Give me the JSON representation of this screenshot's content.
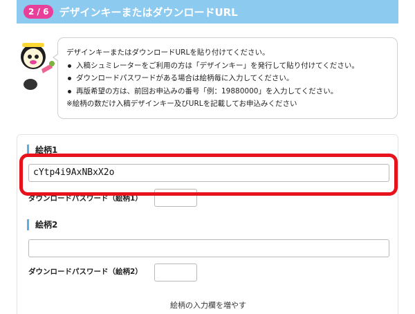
{
  "header": {
    "step": "2 / 6",
    "title": "デザインキーまたはダウンロードURL"
  },
  "info": {
    "lead": "デザインキーまたはダウンロードURLを貼り付けてください。",
    "items": [
      "入稿シュミレーターをご利用の方は「デザインキー」を発行して貼り付けてください。",
      "ダウンロードパスワードがある場合は絵柄毎に入力してください。",
      "再版希望の方は、前回お申込みの番号「例：19880000」を入力してください。"
    ],
    "note": "※絵柄の数だけ入稿デザインキー及びURLを記載してお申込みください"
  },
  "designs": [
    {
      "label": "絵柄1",
      "value": "cYtp4i9AxNBxX2o",
      "password_label": "ダウンロードパスワード（絵柄1）",
      "password_value": ""
    },
    {
      "label": "絵柄2",
      "value": "",
      "password_label": "ダウンロードパスワード（絵柄2）",
      "password_value": ""
    }
  ],
  "add_field_label": "絵柄の入力欄を増やす",
  "colors": {
    "header_bg": "#8dcaf0",
    "badge_bg": "#e8409a",
    "section_marker": "#5aaee2",
    "highlight": "#e8121c"
  }
}
